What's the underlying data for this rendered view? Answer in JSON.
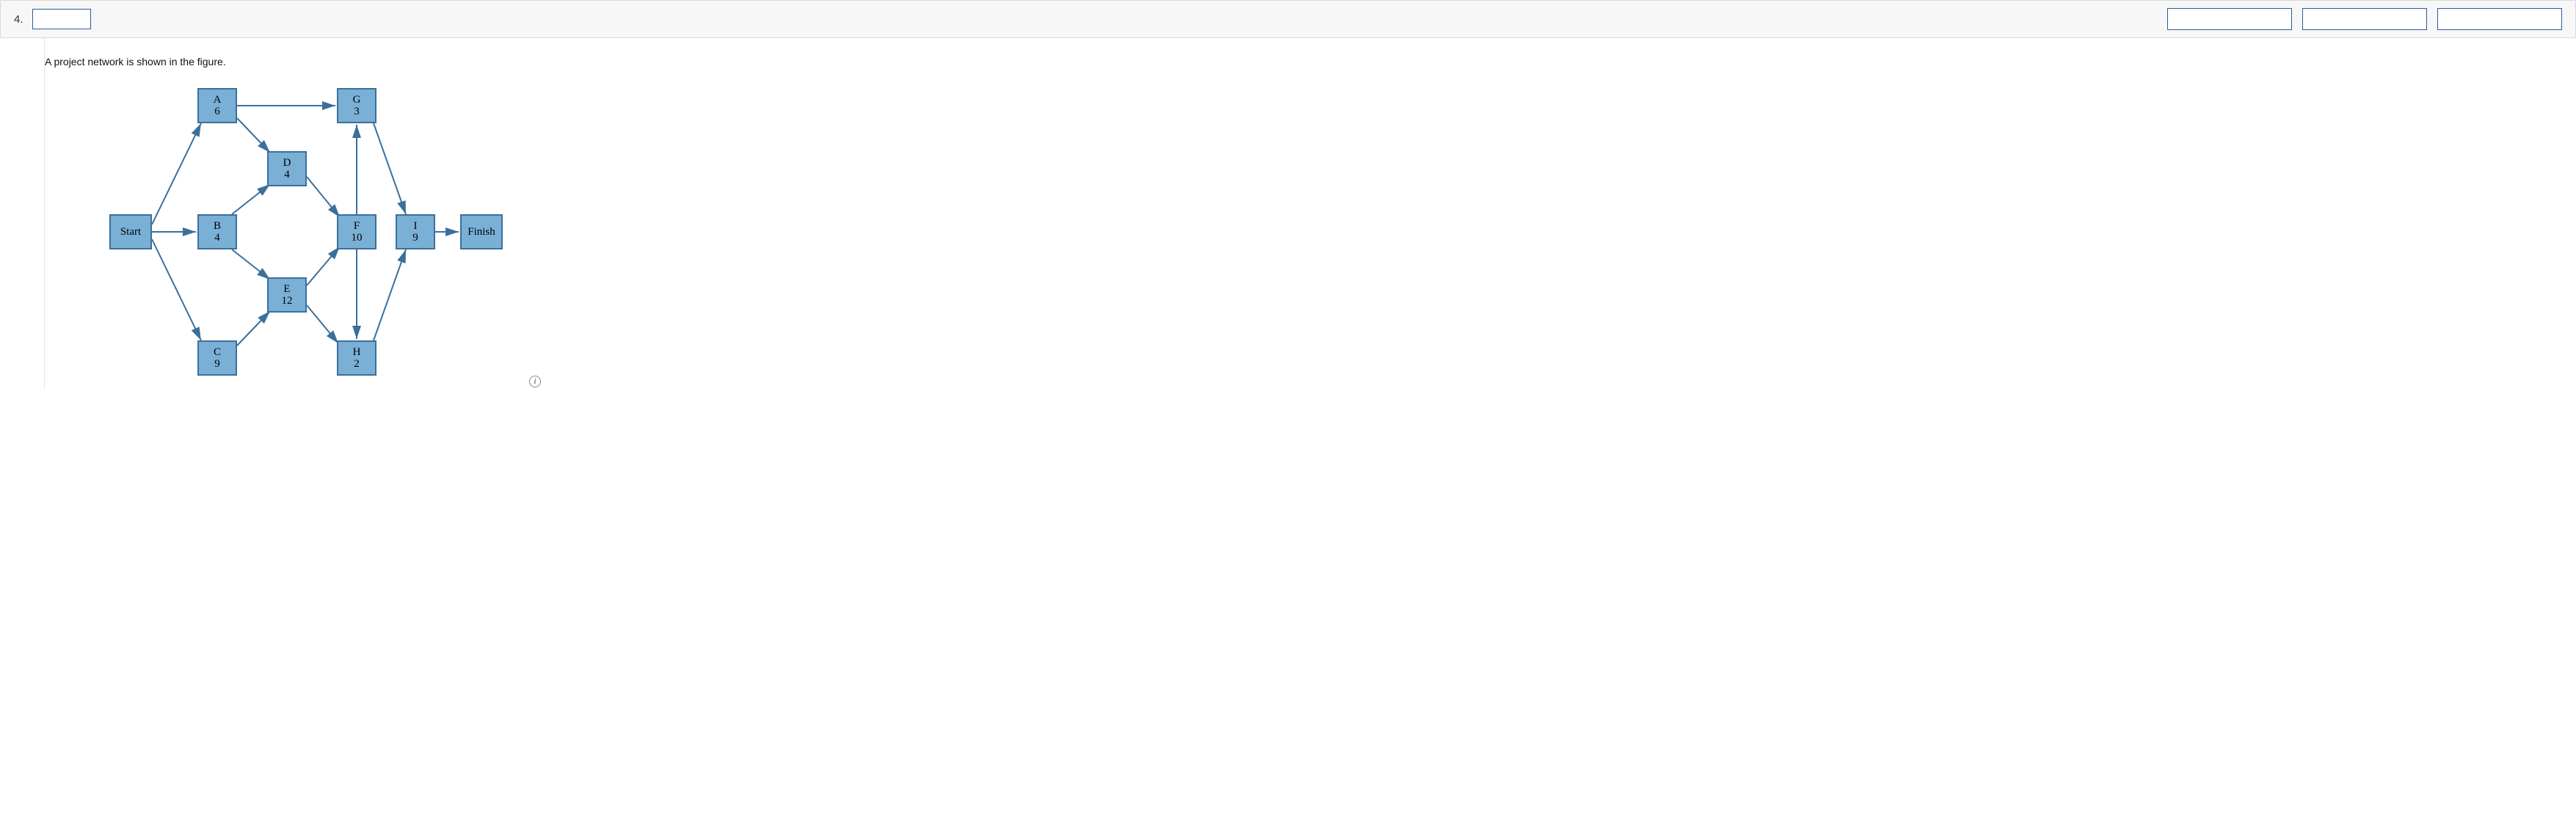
{
  "question": {
    "number": "4.",
    "prompt": "A project network is shown in the figure."
  },
  "header": {
    "points_label": "",
    "buttons": {
      "b1": "",
      "b2": "",
      "b3": ""
    }
  },
  "chart_data": {
    "type": "diagram",
    "title": "Project network",
    "nodes": [
      {
        "id": "Start",
        "label": "Start",
        "duration": null
      },
      {
        "id": "A",
        "label": "A",
        "duration": 6
      },
      {
        "id": "B",
        "label": "B",
        "duration": 4
      },
      {
        "id": "C",
        "label": "C",
        "duration": 9
      },
      {
        "id": "D",
        "label": "D",
        "duration": 4
      },
      {
        "id": "E",
        "label": "E",
        "duration": 12
      },
      {
        "id": "F",
        "label": "F",
        "duration": 10
      },
      {
        "id": "G",
        "label": "G",
        "duration": 3
      },
      {
        "id": "H",
        "label": "H",
        "duration": 2
      },
      {
        "id": "I",
        "label": "I",
        "duration": 9
      },
      {
        "id": "Finish",
        "label": "Finish",
        "duration": null
      }
    ],
    "edges": [
      [
        "Start",
        "A"
      ],
      [
        "Start",
        "B"
      ],
      [
        "Start",
        "C"
      ],
      [
        "A",
        "G"
      ],
      [
        "A",
        "D"
      ],
      [
        "B",
        "D"
      ],
      [
        "B",
        "E"
      ],
      [
        "C",
        "E"
      ],
      [
        "D",
        "F"
      ],
      [
        "E",
        "F"
      ],
      [
        "E",
        "H"
      ],
      [
        "F",
        "G"
      ],
      [
        "F",
        "H"
      ],
      [
        "G",
        "I"
      ],
      [
        "H",
        "I"
      ],
      [
        "I",
        "Finish"
      ]
    ]
  },
  "nodes_display": {
    "Start": {
      "label": "Start"
    },
    "A": {
      "label": "A",
      "dur": "6"
    },
    "B": {
      "label": "B",
      "dur": "4"
    },
    "C": {
      "label": "C",
      "dur": "9"
    },
    "D": {
      "label": "D",
      "dur": "4"
    },
    "E": {
      "label": "E",
      "dur": "12"
    },
    "F": {
      "label": "F",
      "dur": "10"
    },
    "G": {
      "label": "G",
      "dur": "3"
    },
    "H": {
      "label": "H",
      "dur": "2"
    },
    "I": {
      "label": "I",
      "dur": "9"
    },
    "Finish": {
      "label": "Finish"
    }
  }
}
